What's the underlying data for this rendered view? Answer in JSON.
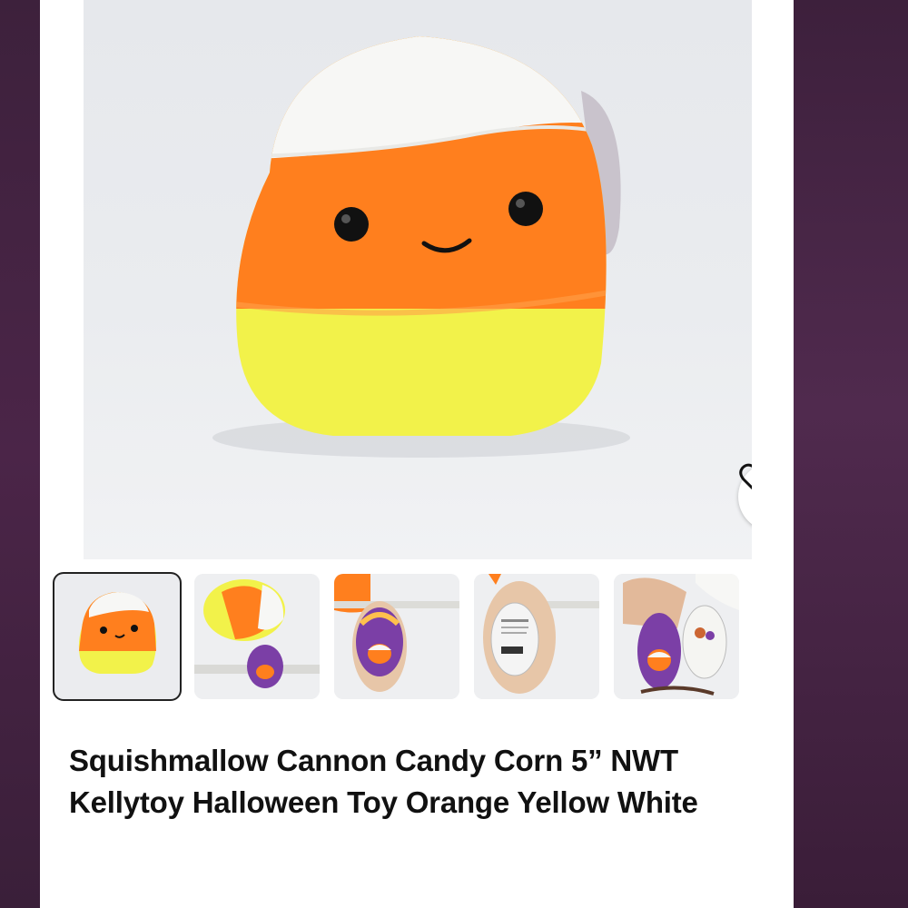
{
  "product": {
    "title": "Squishmallow Cannon Candy Corn 5” NWT Kellytoy Halloween Toy Orange Yellow White",
    "favorite_icon": "heart-outline-icon",
    "main_image_alt": "candy corn plush",
    "thumbnails": [
      {
        "label": "Thumbnail 1",
        "selected": true
      },
      {
        "label": "Thumbnail 2",
        "selected": false
      },
      {
        "label": "Thumbnail 3",
        "selected": false
      },
      {
        "label": "Thumbnail 4",
        "selected": false
      },
      {
        "label": "Thumbnail 5",
        "selected": false
      }
    ]
  },
  "colors": {
    "plush_white": "#f6f6f4",
    "plush_orange": "#ff7f1e",
    "plush_yellow": "#f2f24a",
    "tag_purple": "#7b3fa6",
    "background_purple": "#4a2449"
  }
}
